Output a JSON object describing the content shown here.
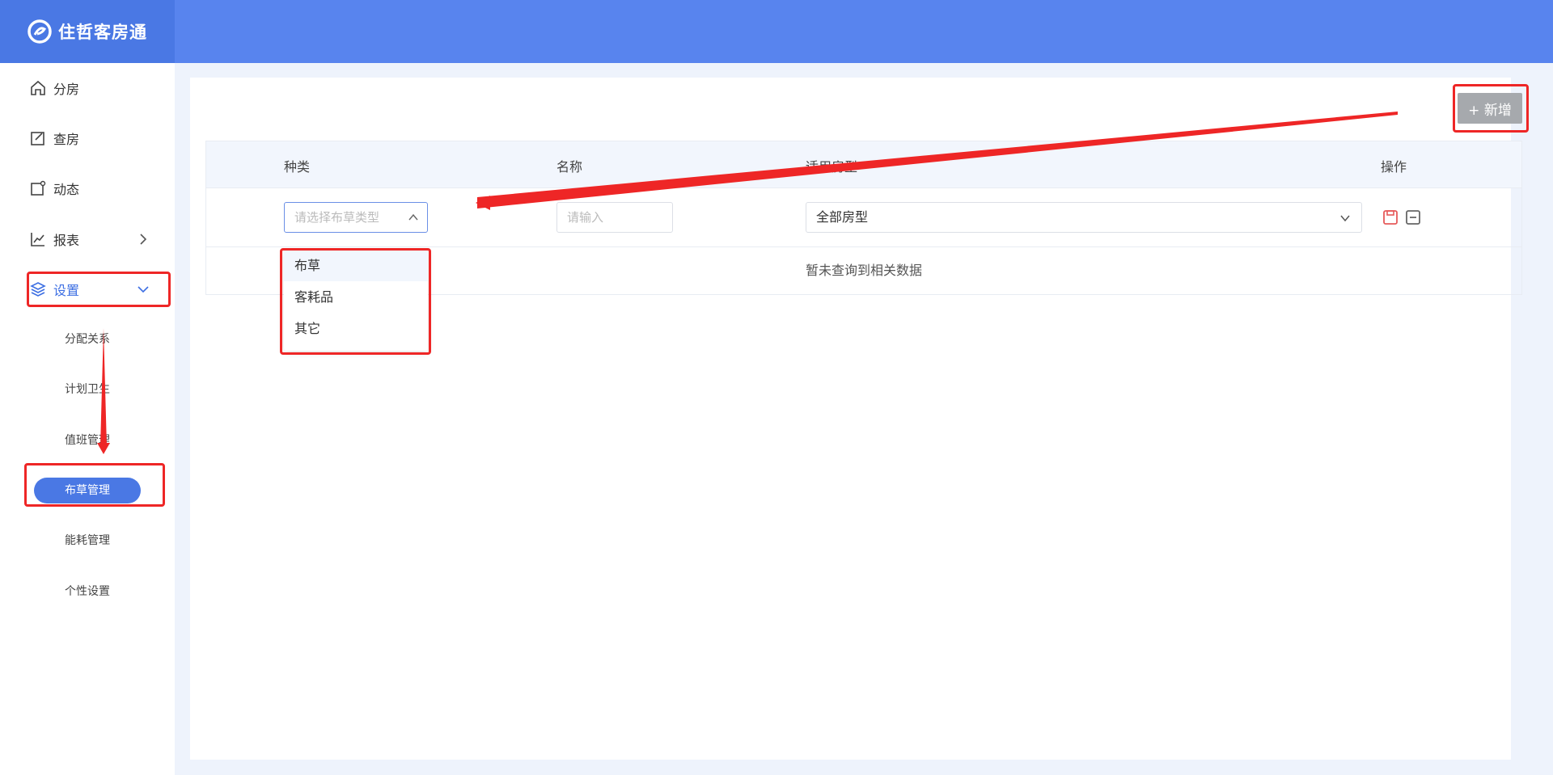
{
  "app": {
    "title": "住哲客房通"
  },
  "sidebar": {
    "items": [
      {
        "label": "分房",
        "icon": "home-icon"
      },
      {
        "label": "查房",
        "icon": "edit-icon"
      },
      {
        "label": "动态",
        "icon": "notification-icon"
      },
      {
        "label": "报表",
        "icon": "chart-icon"
      },
      {
        "label": "设置",
        "icon": "layers-icon"
      }
    ],
    "settings_sub": [
      {
        "label": "分配关系"
      },
      {
        "label": "计划卫生"
      },
      {
        "label": "值班管理"
      },
      {
        "label": "布草管理",
        "active": true
      },
      {
        "label": "能耗管理"
      },
      {
        "label": "个性设置"
      }
    ]
  },
  "toolbar": {
    "add_label": "+ 新增"
  },
  "table": {
    "headers": {
      "type": "种类",
      "name": "名称",
      "room_type": "适用房型",
      "action": "操作"
    },
    "row": {
      "type_placeholder": "请选择布草类型",
      "name_placeholder": "请输入",
      "room_type_value": "全部房型"
    },
    "empty_text": "暂未查询到相关数据"
  },
  "dropdown": {
    "options": [
      "布草",
      "客耗品",
      "其它"
    ]
  },
  "colors": {
    "brand": "#5884ee",
    "highlight": "#ee2626",
    "active": "#4a78e4"
  }
}
